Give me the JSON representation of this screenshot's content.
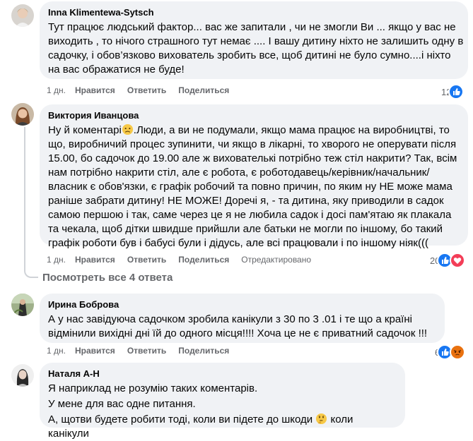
{
  "comments": [
    {
      "author": "Inna Klimentewa-Sytsch",
      "text": "Тут працює людський фактор... вас же запитали , чи не змогли Ви ... якщо у вас не виходить , то нічого страшного тут немає .... І вашу дитину ніхто не залишить одну в садочку, і обов’язково вихователь зробить все, щоб дитині не було сумно....і ніхто на вас ображатися не буде!",
      "time": "1 дн.",
      "like": "Нравится",
      "reply": "Ответить",
      "share": "Поделиться",
      "reaction_count": "12",
      "reactions": [
        "like"
      ]
    },
    {
      "author": "Виктория Иванцова",
      "text_before_emoji": "Ну й коментарі",
      "text_after_emoji": ".Люди, а ви не подумали, якщо мама працює на виробництві, то що, виробничий процес зупинити, чи якщо в лікарні, то хворого не оперувати після 15.00, бо садочок до 19.00 але ж вихователькі потрібно теж стіл накрити? Так, всім нам потрібно накрити стіл, але є робота, є роботодавець/керівник/начальник/ власник є обов'язки, є графік робочий та повно причин, по яким ну НЕ може мама раніше забрати дитину! НЕ МОЖЕ! Доречі я, - та дитина, яку приводили в садок самою першою і так, саме через це я не любила садок і досі пам'ятаю як плакала та чекала, щоб дітки швидше прийшли але батьки не могли по іншому, бо такий графік роботи був і бабусі були і дідусь, але всі працювали і по іншому ніяк(((",
      "time": "1 дн.",
      "like": "Нравится",
      "reply": "Ответить",
      "share": "Поделиться",
      "edited": "Отредактировано",
      "reaction_count": "20",
      "reactions": [
        "like",
        "love"
      ]
    },
    {
      "author": "Ирина Боброва",
      "text": "А у нас завідуюча садочком зробила канікули з 30 по 3 .01 і те що а країні відмінили вихідні дні їй до одного місця!!!! Хоча це не є приватний садочок !!!",
      "time": "1 дн.",
      "like": "Нравится",
      "reply": "Ответить",
      "share": "Поделиться",
      "reaction_count": "6",
      "reactions": [
        "like",
        "angry"
      ]
    },
    {
      "author": "Наталя А-Н",
      "line1": "Я наприклад не розумію таких коментарів.",
      "line2": "У мене для вас одне питання.",
      "line3_before_emoji": "А, щотви будете робити тоді, коли ви підете до шкоди ",
      "line3_after_emoji": " коли канікули"
    }
  ],
  "view_replies": "Посмотреть все 4 ответа",
  "colors": {
    "bubble": "#f0f2f5",
    "meta": "#65676b",
    "like_blue": "#1877f2",
    "love_red": "#f33e58",
    "angry_orange": "#e9710f"
  }
}
